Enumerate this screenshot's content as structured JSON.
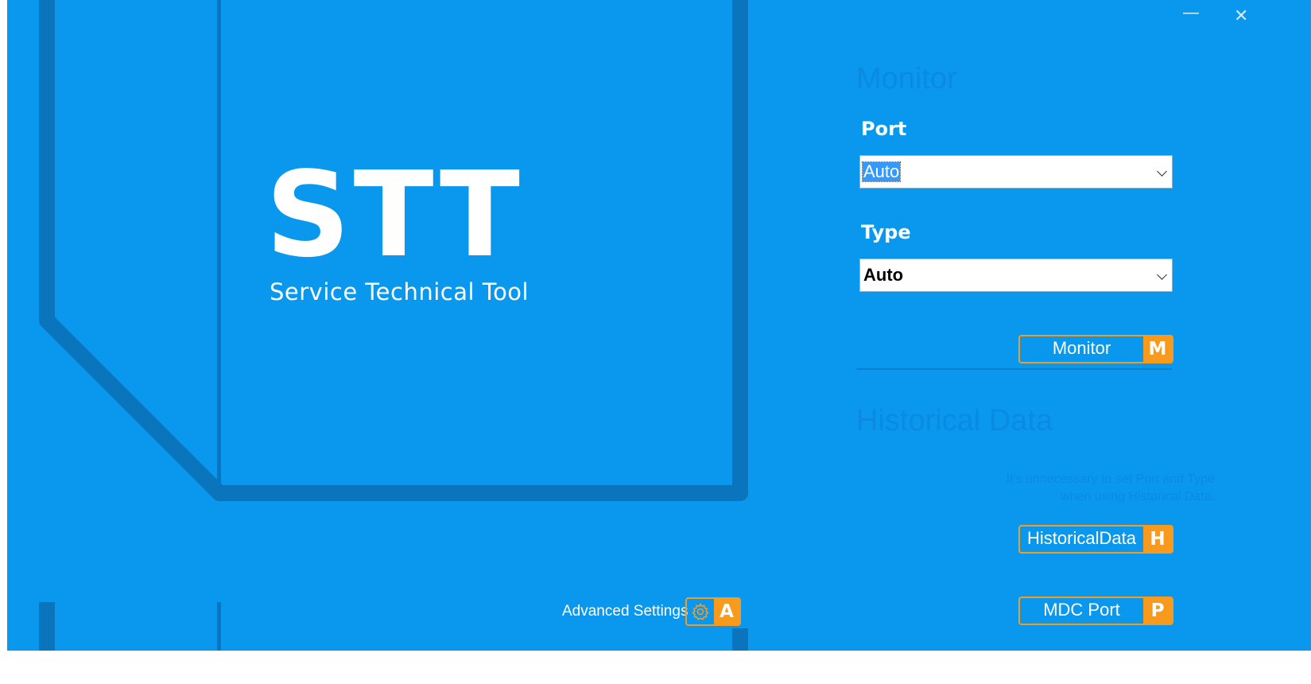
{
  "app": {
    "logo_text": "STT",
    "subtitle": "Service Technical Tool"
  },
  "window": {
    "minimize_icon": "minimize-icon",
    "close_icon": "close-icon"
  },
  "monitor": {
    "section_title": "Monitor",
    "port_label": "Port",
    "port_value": "Auto",
    "type_label": "Type",
    "type_value": "Auto",
    "button_label": "Monitor",
    "button_key": "M"
  },
  "historical": {
    "section_title": "Historical Data",
    "hint_line1": "It's unnecessary to set Port and Type",
    "hint_line2": "when using Historical Data.",
    "button_label": "HistoricalData",
    "button_key": "H"
  },
  "mdc": {
    "button_label": "MDC Port",
    "button_key": "P"
  },
  "advanced": {
    "label": "Advanced Settings",
    "icon": "gear-icon",
    "key": "A"
  },
  "colors": {
    "background": "#0a98ee",
    "accent": "#f79a1e",
    "deco": "#0a74bd",
    "section_title": "#0a8ae0"
  }
}
